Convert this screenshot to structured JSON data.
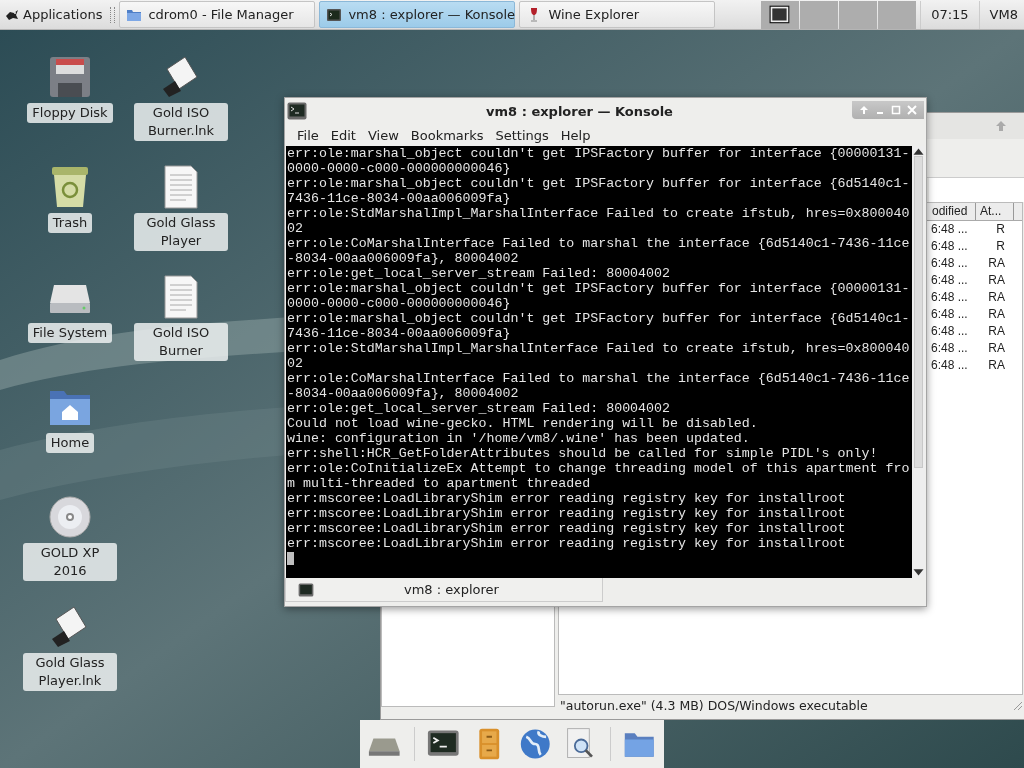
{
  "taskbar": {
    "menu_label": "Applications",
    "tasks": [
      {
        "label": "cdrom0 - File Manager",
        "kind": "folder",
        "selected": false
      },
      {
        "label": "vm8 : explorer — Konsole",
        "kind": "terminal",
        "selected": true
      },
      {
        "label": "Wine Explorer",
        "kind": "wine",
        "selected": false
      }
    ],
    "clock": "07:15",
    "user": "VM8"
  },
  "desktop": {
    "columns": [
      {
        "icons": [
          {
            "label": "Floppy Disk",
            "kind": "floppy"
          },
          {
            "label": "Trash",
            "kind": "trash"
          },
          {
            "label": "File System",
            "kind": "drive"
          },
          {
            "label": "Home",
            "kind": "home"
          },
          {
            "label": "GOLD XP 2016",
            "kind": "disc"
          },
          {
            "label": "Gold Glass Player.lnk",
            "kind": "shortcut"
          }
        ]
      },
      {
        "icons": [
          {
            "label": "Gold ISO Burner.lnk",
            "kind": "shortcut"
          },
          {
            "label": "Gold Glass Player",
            "kind": "document"
          },
          {
            "label": "Gold ISO Burner",
            "kind": "document"
          }
        ]
      }
    ]
  },
  "file_manager": {
    "columns": [
      "odified",
      "At..."
    ],
    "rows": [
      {
        "modified": "6:48 ...",
        "attributes": "R"
      },
      {
        "modified": "6:48 ...",
        "attributes": "R"
      },
      {
        "modified": "6:48 ...",
        "attributes": "RA"
      },
      {
        "modified": "6:48 ...",
        "attributes": "RA"
      },
      {
        "modified": "6:48 ...",
        "attributes": "RA"
      },
      {
        "modified": "6:48 ...",
        "attributes": "RA"
      },
      {
        "modified": "6:48 ...",
        "attributes": "RA"
      },
      {
        "modified": "6:48 ...",
        "attributes": "RA"
      },
      {
        "modified": "6:48 ...",
        "attributes": "RA"
      }
    ],
    "status": "\"autorun.exe\" (4.3 MB) DOS/Windows executable"
  },
  "konsole": {
    "title": "vm8 : explorer — Konsole",
    "menu": [
      "File",
      "Edit",
      "View",
      "Bookmarks",
      "Settings",
      "Help"
    ],
    "lines": [
      "err:ole:marshal_object couldn't get IPSFactory buffer for interface {00000131-",
      "0000-0000-c000-000000000046}",
      "err:ole:marshal_object couldn't get IPSFactory buffer for interface {6d5140c1-",
      "7436-11ce-8034-00aa006009fa}",
      "err:ole:StdMarshalImpl_MarshalInterface Failed to create ifstub, hres=0x800040",
      "02",
      "err:ole:CoMarshalInterface Failed to marshal the interface {6d5140c1-7436-11ce",
      "-8034-00aa006009fa}, 80004002",
      "err:ole:get_local_server_stream Failed: 80004002",
      "err:ole:marshal_object couldn't get IPSFactory buffer for interface {00000131-",
      "0000-0000-c000-000000000046}",
      "err:ole:marshal_object couldn't get IPSFactory buffer for interface {6d5140c1-",
      "7436-11ce-8034-00aa006009fa}",
      "err:ole:StdMarshalImpl_MarshalInterface Failed to create ifstub, hres=0x800040",
      "02",
      "err:ole:CoMarshalInterface Failed to marshal the interface {6d5140c1-7436-11ce",
      "-8034-00aa006009fa}, 80004002",
      "err:ole:get_local_server_stream Failed: 80004002",
      "Could not load wine-gecko. HTML rendering will be disabled.",
      "wine: configuration in '/home/vm8/.wine' has been updated.",
      "err:shell:HCR_GetFolderAttributes should be called for simple PIDL's only!",
      "err:ole:CoInitializeEx Attempt to change threading model of this apartment fro",
      "m multi-threaded to apartment threaded",
      "err:mscoree:LoadLibraryShim error reading registry key for installroot",
      "err:mscoree:LoadLibraryShim error reading registry key for installroot",
      "err:mscoree:LoadLibraryShim error reading registry key for installroot",
      "err:mscoree:LoadLibraryShim error reading registry key for installroot"
    ],
    "tab": "vm8 : explorer"
  }
}
